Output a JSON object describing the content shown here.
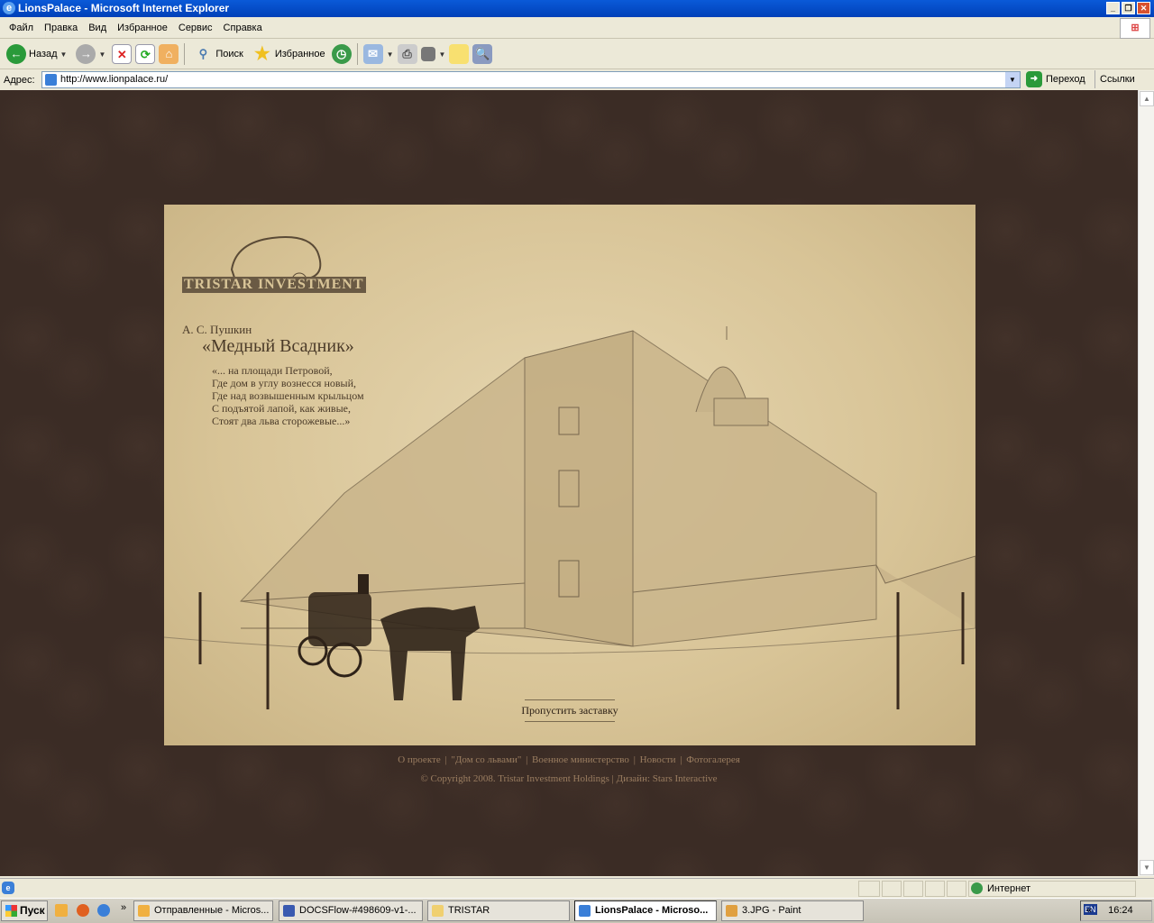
{
  "window": {
    "title": "LionsPalace - Microsoft Internet Explorer"
  },
  "menu": [
    "Файл",
    "Правка",
    "Вид",
    "Избранное",
    "Сервис",
    "Справка"
  ],
  "toolbar": {
    "back": "Назад",
    "search": "Поиск",
    "favorites": "Избранное"
  },
  "address": {
    "label": "Адрес:",
    "url": "http://www.lionpalace.ru/",
    "go": "Переход",
    "links": "Ссылки"
  },
  "page": {
    "logo_text": "TRISTAR INVESTMENT",
    "author": "А. С. Пушкин",
    "poem_title": "«Медный Всадник»",
    "poem_lines": [
      "«... на площади Петровой,",
      "Где дом в углу вознесся новый,",
      "Где над возвышенным крыльцом",
      "С подъятой лапой, как живые,",
      "Стоят два льва сторожевые...»"
    ],
    "skip": "Пропустить заставку",
    "nav": [
      "О проекте",
      "\"Дом со львами\"",
      "Военное министерство",
      "Новости",
      "Фотогалерея"
    ],
    "copyright": "© Copyright 2008. Tristar Investment Holdings",
    "design": "Дизайн: Stars Interactive"
  },
  "status": {
    "zone": "Интернет"
  },
  "taskbar": {
    "start": "Пуск",
    "tasks": [
      "Отправленные - Micros...",
      "DOCSFlow-#498609-v1-...",
      "TRISTAR",
      "LionsPalace - Microso...",
      "3.JPG - Paint"
    ],
    "lang": "EN",
    "clock": "16:24"
  }
}
